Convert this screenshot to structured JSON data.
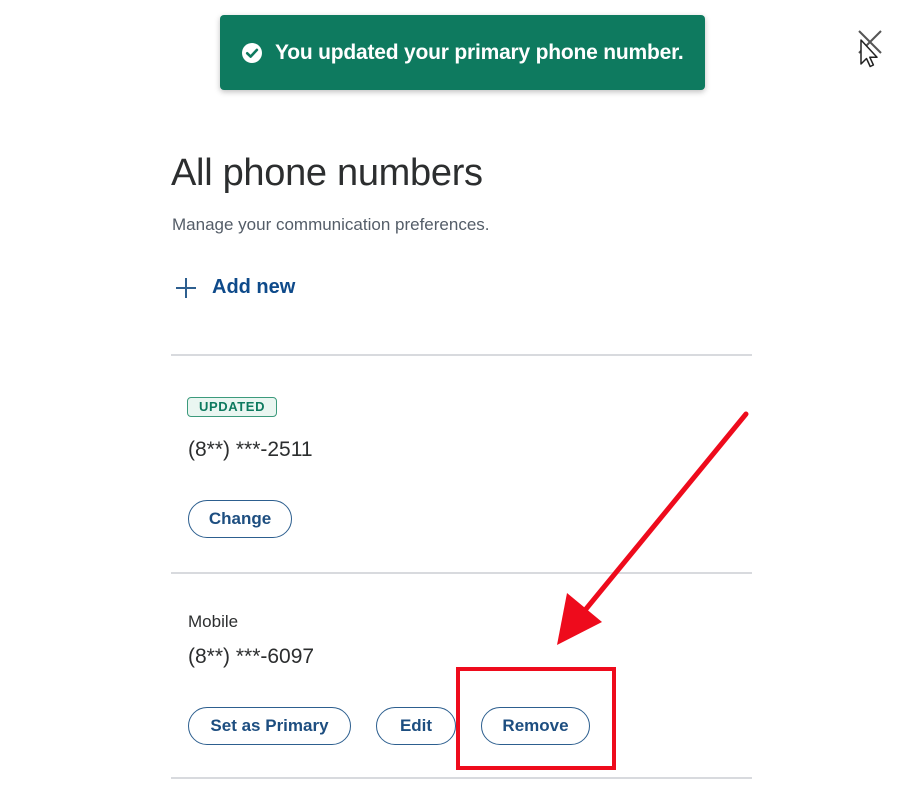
{
  "toast": {
    "message": "You updated your primary phone number.",
    "icon": "check-circle-icon",
    "color": "#0e7a5f"
  },
  "close_icon": "close-icon",
  "header": {
    "title": "All phone numbers",
    "subtitle": "Manage your communication preferences."
  },
  "add_new": {
    "label": "Add new",
    "icon": "plus-icon"
  },
  "phones": [
    {
      "badge": "UPDATED",
      "number": "(8**) ***-2511",
      "actions": [
        "Change"
      ]
    },
    {
      "label": "Mobile",
      "number": "(8**) ***-6097",
      "actions": [
        "Set as Primary",
        "Edit",
        "Remove"
      ]
    }
  ],
  "annotation": {
    "color": "#ee0b1c",
    "target": "Remove"
  },
  "colors": {
    "link": "#0e4a8a",
    "button_border": "#2d5f8f",
    "divider": "#d8dade"
  }
}
